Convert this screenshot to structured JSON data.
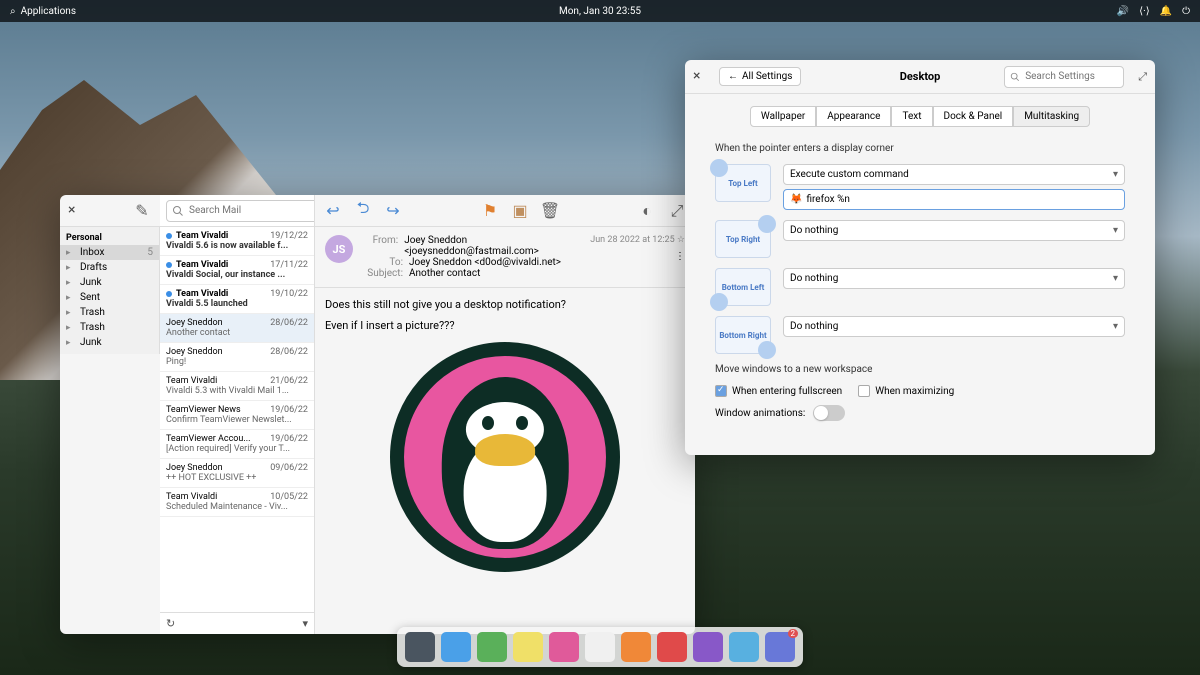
{
  "topbar": {
    "apps": "Applications",
    "datetime": "Mon, Jan 30   23:55"
  },
  "mail": {
    "search_placeholder": "Search Mail",
    "sidebar": {
      "header": "Personal",
      "items": [
        {
          "label": "Inbox",
          "count": "5",
          "selected": true
        },
        {
          "label": "Drafts"
        },
        {
          "label": "Junk"
        },
        {
          "label": "Sent"
        },
        {
          "label": "Trash"
        },
        {
          "label": "Trash"
        },
        {
          "label": "Junk"
        }
      ]
    },
    "messages": [
      {
        "from": "Team Vivaldi",
        "date": "19/12/22",
        "subj": "Vivaldi 5.6 is now available f...",
        "unread": true,
        "bold": true
      },
      {
        "from": "Team Vivaldi",
        "date": "17/11/22",
        "subj": "Vivaldi Social, our instance ...",
        "unread": true,
        "bold": true
      },
      {
        "from": "Team Vivaldi",
        "date": "19/10/22",
        "subj": "Vivaldi 5.5 launched",
        "unread": true,
        "bold": true
      },
      {
        "from": "Joey Sneddon",
        "date": "28/06/22",
        "subj": "Another contact",
        "selected": true
      },
      {
        "from": "Joey Sneddon",
        "date": "28/06/22",
        "subj": "Ping!"
      },
      {
        "from": "Team Vivaldi",
        "date": "21/06/22",
        "subj": "Vivaldi 5.3 with Vivaldi Mail 1..."
      },
      {
        "from": "TeamViewer News",
        "date": "19/06/22",
        "subj": "Confirm TeamViewer Newslet..."
      },
      {
        "from": "TeamViewer Accou...",
        "date": "19/06/22",
        "subj": "[Action required] Verify your T..."
      },
      {
        "from": "Joey Sneddon",
        "date": "09/06/22",
        "subj": "++ HOT EXCLUSIVE ++"
      },
      {
        "from": "Team Vivaldi",
        "date": "10/05/22",
        "subj": "Scheduled Maintenance - Viv..."
      }
    ],
    "view": {
      "avatar": "JS",
      "from_label": "From:",
      "from": "Joey Sneddon <joeysneddon@fastmail.com>",
      "to_label": "To:",
      "to": "Joey Sneddon <d0od@vivaldi.net>",
      "subject_label": "Subject:",
      "subject": "Another contact",
      "date": "Jun 28 2022 at 12:25",
      "body1": "Does this still not give you a desktop notification?",
      "body2": "Even if I insert a picture???"
    }
  },
  "settings": {
    "back": "All Settings",
    "title": "Desktop",
    "search_placeholder": "Search Settings",
    "tabs": [
      "Wallpaper",
      "Appearance",
      "Text",
      "Dock & Panel",
      "Multitasking"
    ],
    "active_tab": 4,
    "hotcorners_label": "When the pointer enters a display corner",
    "corners": {
      "tl": {
        "label": "Top Left",
        "action": "Execute custom command",
        "command": "firefox %n"
      },
      "tr": {
        "label": "Top Right",
        "action": "Do nothing"
      },
      "bl": {
        "label": "Bottom Left",
        "action": "Do nothing"
      },
      "br": {
        "label": "Bottom Right",
        "action": "Do nothing"
      }
    },
    "move_label": "Move windows to a new workspace",
    "move_fullscreen": "When entering fullscreen",
    "move_maximize": "When maximizing",
    "animations_label": "Window animations:"
  },
  "dock": {
    "apps": [
      {
        "name": "multitasking",
        "color": "#4a5560"
      },
      {
        "name": "files",
        "color": "#4aa0e8"
      },
      {
        "name": "browser",
        "color": "#5ab05a"
      },
      {
        "name": "mail",
        "color": "#f0e068"
      },
      {
        "name": "tasks",
        "color": "#e05a9a"
      },
      {
        "name": "calendar",
        "color": "#f0f0f0"
      },
      {
        "name": "music",
        "color": "#f08838"
      },
      {
        "name": "videos",
        "color": "#e04a4a"
      },
      {
        "name": "photos",
        "color": "#8858c8"
      },
      {
        "name": "settings",
        "color": "#58b0e0"
      },
      {
        "name": "appcenter",
        "color": "#6878d8",
        "badge": "2"
      }
    ]
  }
}
